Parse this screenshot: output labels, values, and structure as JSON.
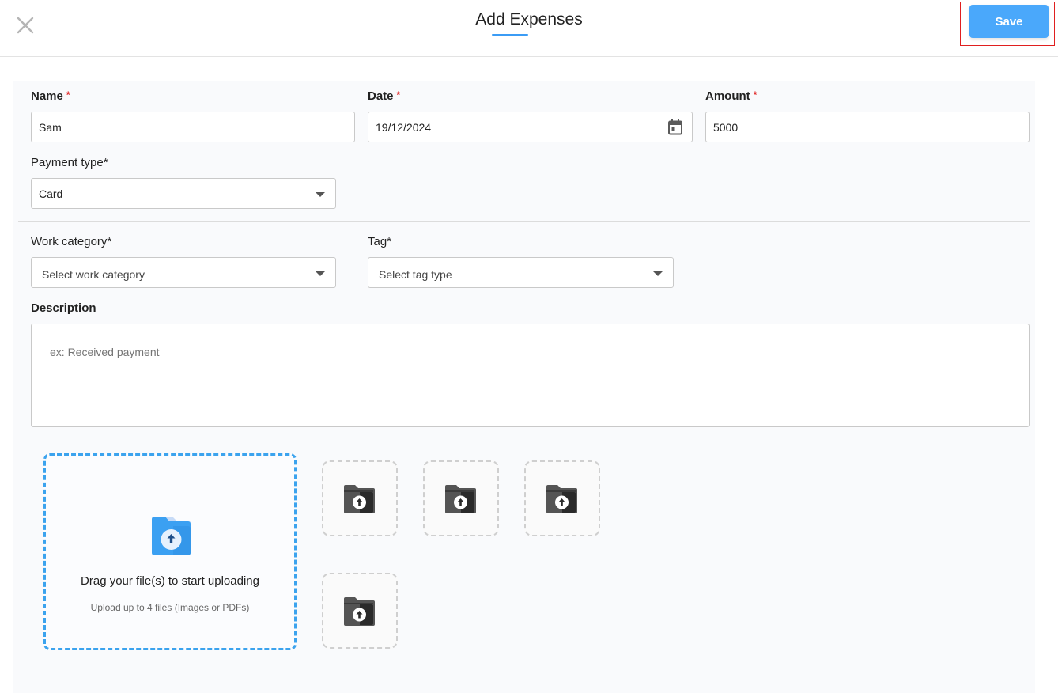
{
  "header": {
    "title": "Add Expenses",
    "save_label": "Save",
    "close_icon": "close-icon"
  },
  "form": {
    "name": {
      "label": "Name",
      "required_mark": "*",
      "value": "Sam"
    },
    "date": {
      "label": "Date",
      "required_mark": "*",
      "value": "19/12/2024",
      "icon": "calendar-icon"
    },
    "amount": {
      "label": "Amount",
      "required_mark": "*",
      "value": "5000"
    },
    "payment_type": {
      "label": "Payment type*",
      "value": "Card"
    },
    "work_category": {
      "label": "Work category*",
      "placeholder": "Select work category"
    },
    "tag": {
      "label": "Tag*",
      "placeholder": "Select tag type"
    },
    "description": {
      "label": "Description",
      "placeholder": "ex: Received payment",
      "value": ""
    }
  },
  "upload": {
    "title": "Drag your file(s) to start uploading",
    "subtitle": "Upload up to 4 files (Images or PDFs)",
    "slot_count": 4
  },
  "colors": {
    "accent": "#4aa8fb",
    "dropzone_border": "#3ba3ee",
    "required": "#e02424",
    "highlight_box": "#e01f1f"
  }
}
